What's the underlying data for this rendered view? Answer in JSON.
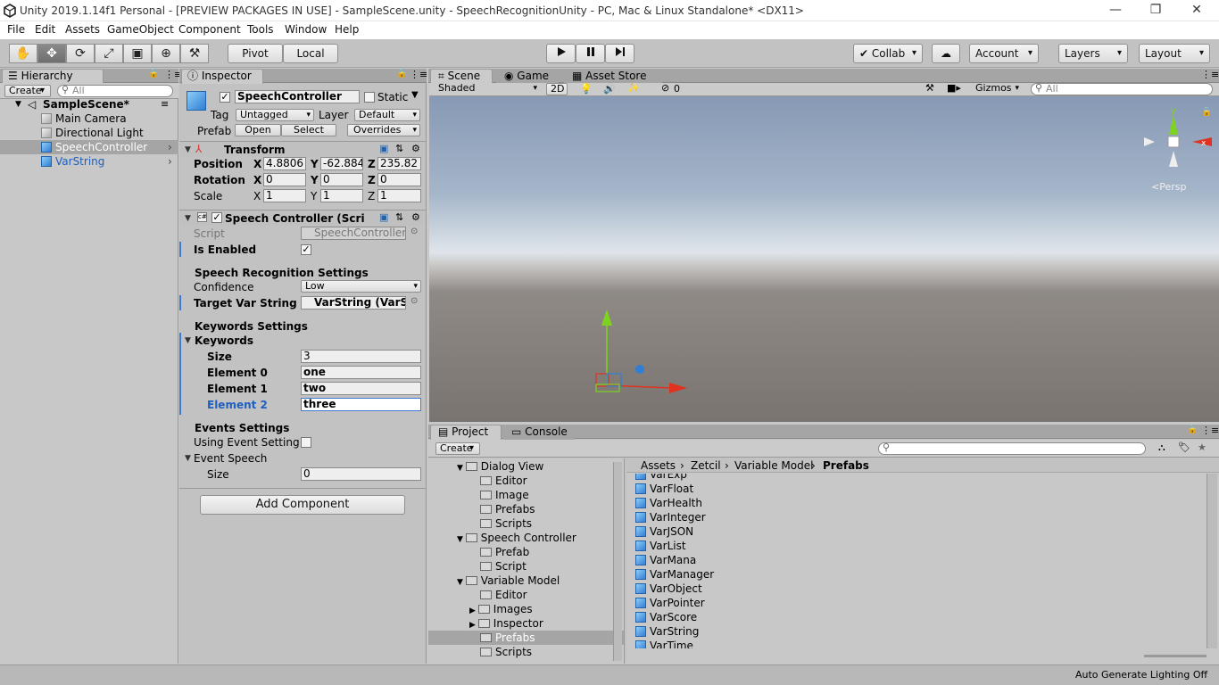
{
  "window": {
    "title": "Unity 2019.1.14f1 Personal - [PREVIEW PACKAGES IN USE] - SampleScene.unity - SpeechRecognitionUnity - PC, Mac & Linux Standalone* <DX11>",
    "min": "—",
    "max": "❐",
    "close": "✕"
  },
  "menu": [
    "File",
    "Edit",
    "Assets",
    "GameObject",
    "Component",
    "Tools",
    "Window",
    "Help"
  ],
  "toolbar": {
    "pivot": "Pivot",
    "local": "Local",
    "collab": "Collab",
    "account": "Account",
    "layers": "Layers",
    "layout": "Layout"
  },
  "hierarchy": {
    "tab": "Hierarchy",
    "create": "Create",
    "search_placeholder": "All",
    "scene": "SampleScene*",
    "items": [
      "Main Camera",
      "Directional Light",
      "SpeechController",
      "VarString"
    ]
  },
  "inspector": {
    "tab": "Inspector",
    "object_name": "SpeechController",
    "static_label": "Static",
    "tag_label": "Tag",
    "tag_value": "Untagged",
    "layer_label": "Layer",
    "layer_value": "Default",
    "prefab_label": "Prefab",
    "open": "Open",
    "select": "Select",
    "overrides": "Overrides",
    "transform": {
      "title": "Transform",
      "position_label": "Position",
      "rotation_label": "Rotation",
      "scale_label": "Scale",
      "position": [
        "4.8806",
        "-62.884",
        "235.82"
      ],
      "rotation": [
        "0",
        "0",
        "0"
      ],
      "scale": [
        "1",
        "1",
        "1"
      ],
      "axes": [
        "X",
        "Y",
        "Z"
      ]
    },
    "component": {
      "title": "Speech Controller (Scri",
      "script_label": "Script",
      "script_value": "SpeechController",
      "is_enabled_label": "Is Enabled",
      "speech_settings_header": "Speech Recognition Settings",
      "confidence_label": "Confidence",
      "confidence_value": "Low",
      "target_label": "Target Var String",
      "target_value": "VarString (VarS",
      "keywords_header": "Keywords Settings",
      "keywords_label": "Keywords",
      "size_label": "Size",
      "size_value": "3",
      "elements": [
        {
          "label": "Element 0",
          "value": "one"
        },
        {
          "label": "Element 1",
          "value": "two"
        },
        {
          "label": "Element 2",
          "value": "three"
        }
      ],
      "events_header": "Events Settings",
      "using_event_label": "Using Event Setting",
      "event_speech_label": "Event Speech",
      "event_size_label": "Size",
      "event_size_value": "0"
    },
    "add_component": "Add Component"
  },
  "scene_view": {
    "tabs": [
      "Scene",
      "Game",
      "Asset Store"
    ],
    "shading": "Shaded",
    "mode_2d": "2D",
    "hidden_count": "0",
    "gizmos": "Gizmos",
    "search_placeholder": "All",
    "persp": "Persp"
  },
  "project": {
    "tabs": [
      "Project",
      "Console"
    ],
    "create": "Create",
    "breadcrumb": [
      "Assets",
      "Zetcil",
      "Variable Model",
      "Prefabs"
    ],
    "tree": [
      {
        "label": "Dialog View",
        "level": 0,
        "open": true
      },
      {
        "label": "Editor",
        "level": 1
      },
      {
        "label": "Image",
        "level": 1
      },
      {
        "label": "Prefabs",
        "level": 1
      },
      {
        "label": "Scripts",
        "level": 1
      },
      {
        "label": "Speech Controller",
        "level": 0,
        "open": true
      },
      {
        "label": "Prefab",
        "level": 1
      },
      {
        "label": "Script",
        "level": 1
      },
      {
        "label": "Variable Model",
        "level": 0,
        "open": true
      },
      {
        "label": "Editor",
        "level": 1
      },
      {
        "label": "Images",
        "level": 1,
        "closed": true
      },
      {
        "label": "Inspector",
        "level": 1,
        "closed": true
      },
      {
        "label": "Prefabs",
        "level": 1,
        "selected": true
      },
      {
        "label": "Scripts",
        "level": 1
      }
    ],
    "files": [
      "VarExp",
      "VarFloat",
      "VarHealth",
      "VarInteger",
      "VarJSON",
      "VarList",
      "VarMana",
      "VarManager",
      "VarObject",
      "VarPointer",
      "VarScore",
      "VarString",
      "VarTime"
    ]
  },
  "status": {
    "text": "Auto Generate Lighting Off"
  },
  "colors": {
    "selection": "#3b7bd4",
    "accent_blue": "#1f5fc0"
  }
}
